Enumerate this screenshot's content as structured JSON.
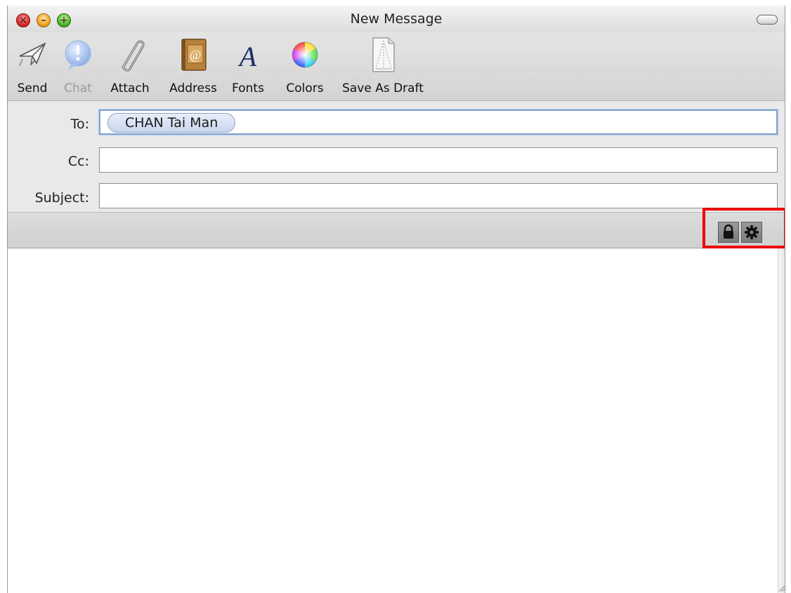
{
  "window": {
    "title": "New Message"
  },
  "toolbar": {
    "items": [
      {
        "label": "Send",
        "icon": "send-icon",
        "enabled": true
      },
      {
        "label": "Chat",
        "icon": "chat-icon",
        "enabled": false
      },
      {
        "label": "Attach",
        "icon": "paperclip-icon",
        "enabled": true
      },
      {
        "label": "Address",
        "icon": "address-book-icon",
        "enabled": true
      },
      {
        "label": "Fonts",
        "icon": "fonts-icon",
        "enabled": true
      },
      {
        "label": "Colors",
        "icon": "color-wheel-icon",
        "enabled": true
      },
      {
        "label": "Save As Draft",
        "icon": "draft-icon",
        "enabled": true
      }
    ]
  },
  "headers": {
    "to_label": "To:",
    "to_recipient": "CHAN Tai Man",
    "cc_label": "Cc:",
    "cc_value": "",
    "subject_label": "Subject:",
    "subject_value": ""
  },
  "security": {
    "sign_icon": "lock-icon",
    "encrypt_icon": "gear-icon",
    "highlight_color": "#ee0000"
  },
  "body": {
    "text": ""
  }
}
